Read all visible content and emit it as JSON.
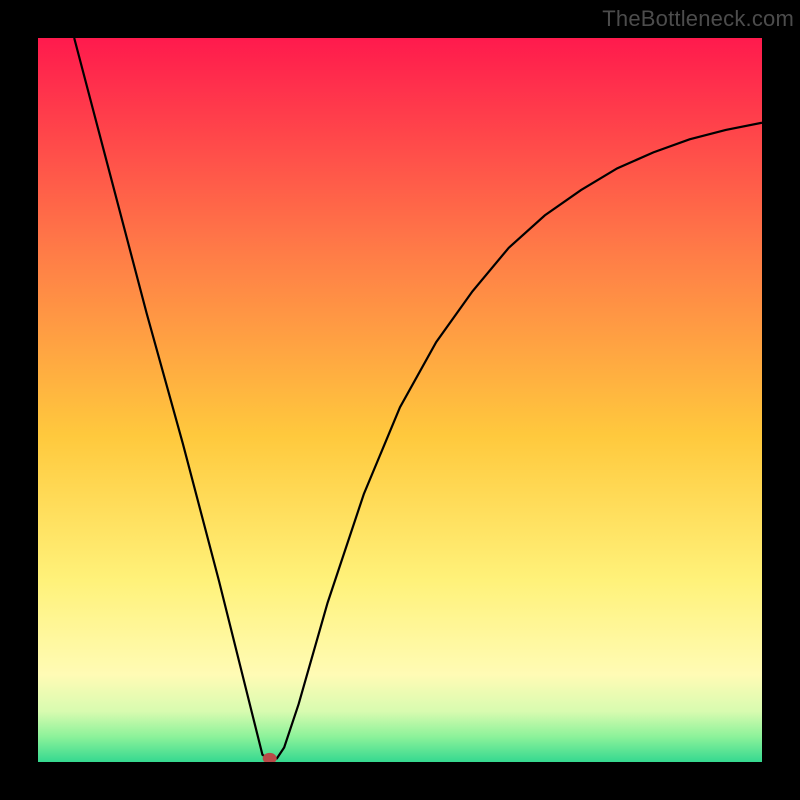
{
  "watermark": "TheBottleneck.com",
  "chart_data": {
    "type": "line",
    "title": "",
    "xlabel": "",
    "ylabel": "",
    "xlim": [
      0,
      100
    ],
    "ylim": [
      0,
      100
    ],
    "grid": false,
    "legend": false,
    "series": [
      {
        "name": "curve",
        "x": [
          5,
          10,
          15,
          20,
          25,
          28,
          30,
          31,
          32,
          33,
          34,
          36,
          40,
          45,
          50,
          55,
          60,
          65,
          70,
          75,
          80,
          85,
          90,
          95,
          100
        ],
        "y": [
          100,
          81,
          62,
          44,
          25,
          13,
          5,
          1,
          0.3,
          0.5,
          2,
          8,
          22,
          37,
          49,
          58,
          65,
          71,
          75.5,
          79,
          82,
          84.2,
          86,
          87.3,
          88.3
        ]
      }
    ],
    "marker": {
      "x": 32,
      "y": 0.5
    },
    "background_gradient": [
      "#ff1a4d",
      "#ff7d47",
      "#ffc93d",
      "#fff27a",
      "#fffbb5",
      "#d8fbb0",
      "#8cf29a",
      "#35d990"
    ]
  },
  "colors": {
    "frame": "#000000",
    "curve": "#000000",
    "marker": "#b94a48",
    "watermark": "#4c4c4c"
  }
}
